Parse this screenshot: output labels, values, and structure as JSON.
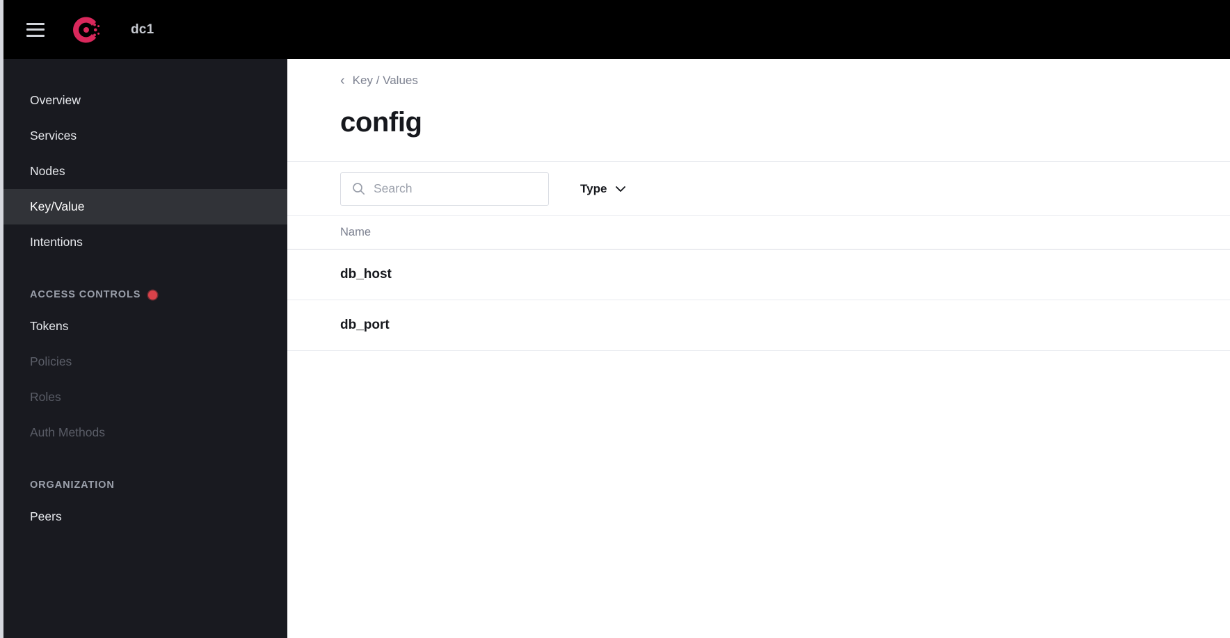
{
  "topbar": {
    "menu_icon": "hamburger-menu-icon",
    "logo_icon": "consul-logo-icon",
    "datacenter": "dc1"
  },
  "sidebar": {
    "items": [
      {
        "label": "Overview",
        "state": "normal",
        "name": "overview"
      },
      {
        "label": "Services",
        "state": "normal",
        "name": "services"
      },
      {
        "label": "Nodes",
        "state": "normal",
        "name": "nodes"
      },
      {
        "label": "Key/Value",
        "state": "active",
        "name": "key-value"
      },
      {
        "label": "Intentions",
        "state": "normal",
        "name": "intentions"
      }
    ],
    "sections": [
      {
        "label": "ACCESS CONTROLS",
        "badge": "status-dot",
        "badge_color": "#d8424a",
        "items": [
          {
            "label": "Tokens",
            "state": "normal",
            "name": "tokens"
          },
          {
            "label": "Policies",
            "state": "disabled",
            "name": "policies"
          },
          {
            "label": "Roles",
            "state": "disabled",
            "name": "roles"
          },
          {
            "label": "Auth Methods",
            "state": "disabled",
            "name": "auth-methods"
          }
        ]
      },
      {
        "label": "ORGANIZATION",
        "badge": null,
        "badge_color": null,
        "items": [
          {
            "label": "Peers",
            "state": "normal",
            "name": "peers"
          }
        ]
      }
    ]
  },
  "main": {
    "breadcrumb": {
      "chevron": "‹",
      "label": "Key / Values"
    },
    "title": "config",
    "search": {
      "placeholder": "Search",
      "value": "",
      "icon": "search-icon"
    },
    "type_filter": {
      "label": "Type",
      "icon": "chevron-down-icon"
    },
    "table": {
      "columns": [
        "Name"
      ],
      "rows": [
        {
          "name": "db_host"
        },
        {
          "name": "db_port"
        }
      ]
    }
  },
  "colors": {
    "topbar_bg": "#000000",
    "sidebar_bg": "#191a20",
    "sidebar_active_bg": "#313338",
    "brand_pink": "#d9285c",
    "text_light": "#e6e8ec",
    "text_muted": "#7c8190",
    "text_dark": "#16181d",
    "divider": "#e8eaef"
  }
}
